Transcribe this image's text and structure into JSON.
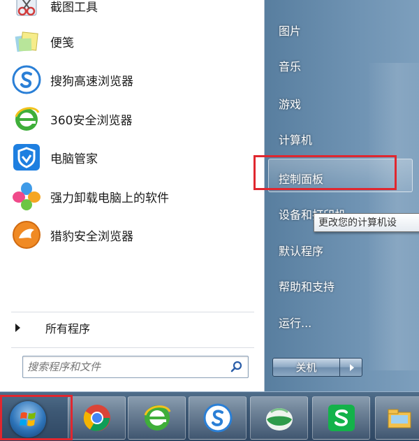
{
  "start_menu": {
    "programs": [
      {
        "label": "截图工具",
        "icon": "scissors-icon"
      },
      {
        "label": "便笺",
        "icon": "sticky-notes-icon"
      },
      {
        "label": "搜狗高速浏览器",
        "icon": "sogou-browser-icon"
      },
      {
        "label": "360安全浏览器",
        "icon": "360-browser-icon"
      },
      {
        "label": "电脑管家",
        "icon": "pc-manager-shield-icon"
      },
      {
        "label": "强力卸载电脑上的软件",
        "icon": "uninstaller-icon"
      },
      {
        "label": "猎豹安全浏览器",
        "icon": "cheetah-browser-icon"
      }
    ],
    "all_programs_label": "所有程序",
    "search_placeholder": "搜索程序和文件",
    "right_items": [
      {
        "label": "图片"
      },
      {
        "label": "音乐"
      },
      {
        "label": "游戏"
      },
      {
        "label": "计算机"
      },
      {
        "label": "控制面板"
      },
      {
        "label": "设备和打印机"
      },
      {
        "label": "默认程序"
      },
      {
        "label": "帮助和支持"
      },
      {
        "label": "运行..."
      }
    ],
    "tooltip": "更改您的计算机设",
    "shutdown_label": "关机"
  },
  "taskbar": {
    "items": [
      {
        "icon": "start-orb-icon"
      },
      {
        "icon": "chrome-icon"
      },
      {
        "icon": "360-browser-icon"
      },
      {
        "icon": "sogou-browser-icon"
      },
      {
        "icon": "green-app-icon"
      },
      {
        "icon": "wps-spreadsheet-icon"
      },
      {
        "icon": "file-explorer-icon"
      }
    ]
  },
  "colors": {
    "highlight_red": "#e0272f",
    "menu_right_pane": "#6f93b3",
    "taskbar": "#3d5874"
  }
}
